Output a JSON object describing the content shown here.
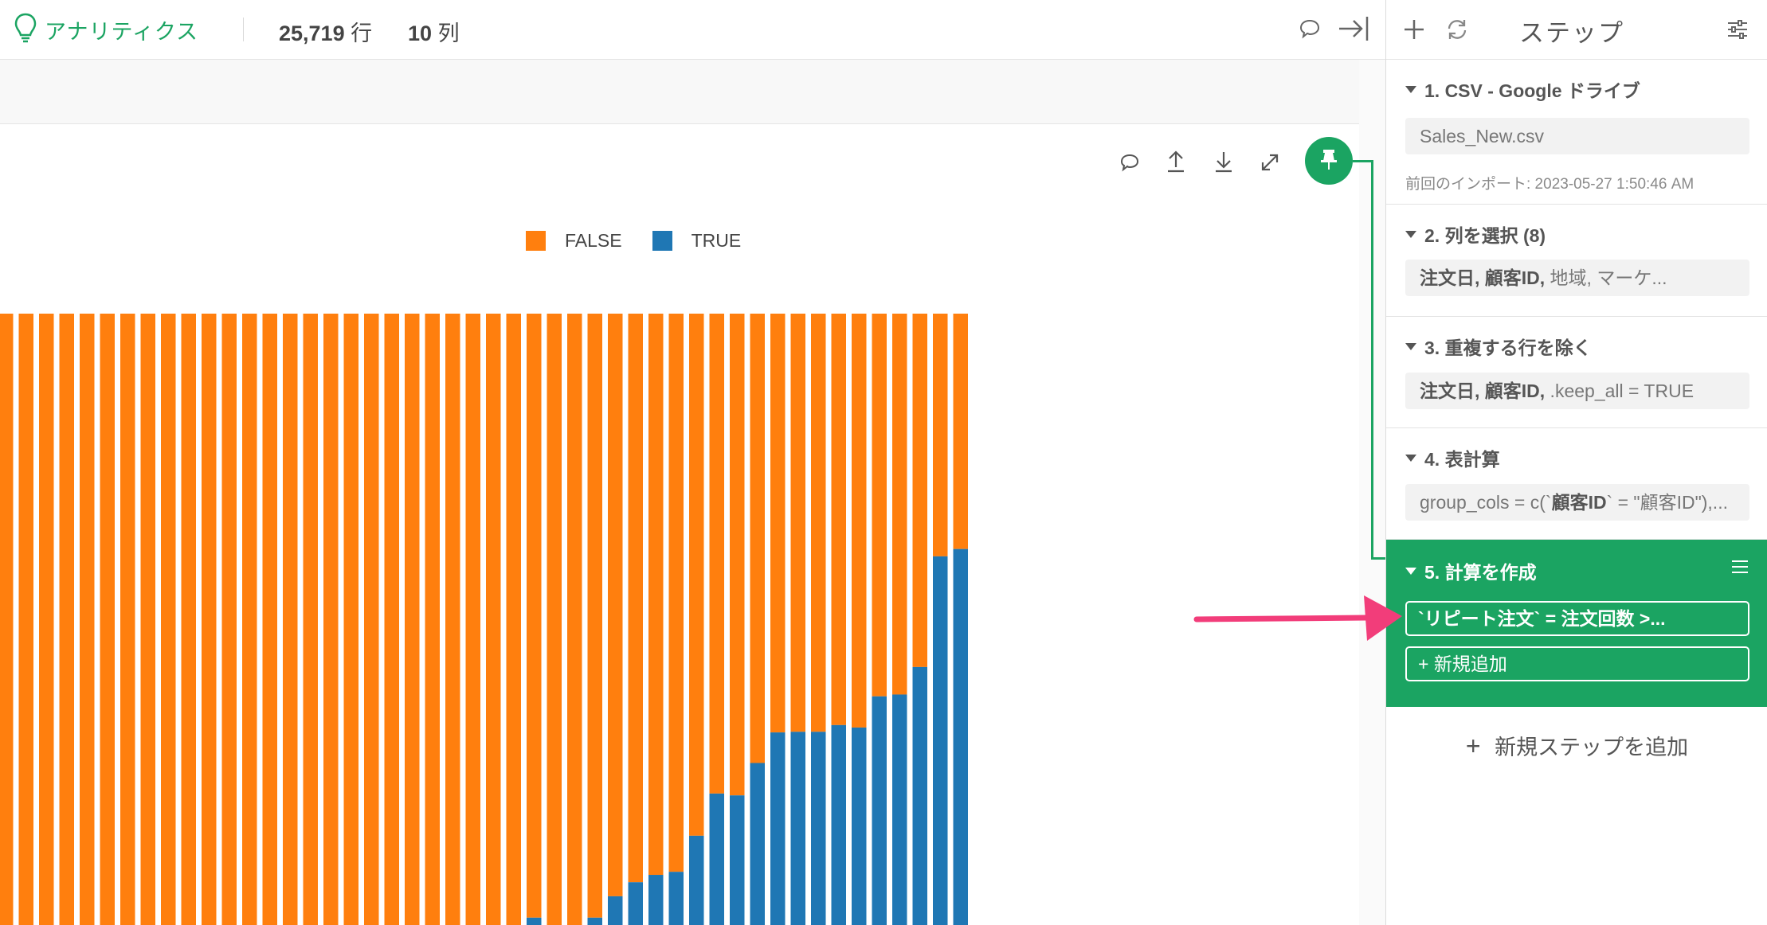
{
  "header": {
    "app_title": "アナリティクス",
    "row_count": "25,719",
    "row_unit": "行",
    "col_count": "10",
    "col_unit": "列"
  },
  "icons": {
    "brand": "lightbulb-icon",
    "comment": "comment-icon",
    "collapse": "collapse-right-icon",
    "upload": "upload-icon",
    "download": "download-icon",
    "expand": "expand-icon",
    "pin": "pin-icon",
    "add": "plus-icon",
    "refresh": "refresh-icon",
    "settings": "sliders-icon",
    "menu": "hamburger-icon"
  },
  "colors": {
    "brand": "#1ba462",
    "false_series": "#ff7f0e",
    "true_series": "#1f77b4",
    "annotation_arrow": "#f23d7a"
  },
  "panel": {
    "title": "ステップ",
    "steps": [
      {
        "title": "1. CSV - Google ドライブ",
        "content": "Sales_New.csv",
        "note": "前回のインポート: 2023-05-27 1:50:46 AM"
      },
      {
        "title": "2. 列を選択 (8)",
        "content_bold": "注文日, 顧客ID,",
        "content_rest": " 地域, マーケ..."
      },
      {
        "title": "3. 重複する行を除く",
        "content_bold": "注文日, 顧客ID,",
        "content_rest": " .keep_all = TRUE"
      },
      {
        "title": "4. 表計算",
        "content_pre": "group_cols = c(`",
        "content_bold": "顧客ID",
        "content_rest": "` = \"顧客ID\"),..."
      },
      {
        "title": "5. 計算を作成",
        "field": "`リピート注文` = 注文回数 >...",
        "add_new": "新規追加",
        "active": true
      }
    ],
    "add_step": "新規ステップを追加"
  },
  "chart_data": {
    "type": "bar",
    "stacked": true,
    "normalized": true,
    "legend_position": "top-center",
    "series": [
      {
        "name": "FALSE",
        "values": [
          1,
          1,
          1,
          1,
          1,
          1,
          1,
          1,
          1,
          1,
          1,
          1,
          1,
          1,
          1,
          1,
          1,
          1,
          1,
          1,
          1,
          1,
          1,
          1,
          1,
          1,
          0.988,
          1,
          1,
          0.988,
          0.953,
          0.93,
          0.918,
          0.913,
          0.854,
          0.785,
          0.788,
          0.735,
          0.685,
          0.684,
          0.684,
          0.673,
          0.677,
          0.626,
          0.623,
          0.578,
          0.397,
          0.385
        ]
      },
      {
        "name": "TRUE",
        "values": [
          0,
          0,
          0,
          0,
          0,
          0,
          0,
          0,
          0,
          0,
          0,
          0,
          0,
          0,
          0,
          0,
          0,
          0,
          0,
          0,
          0,
          0,
          0,
          0,
          0,
          0,
          0.012,
          0,
          0,
          0.012,
          0.047,
          0.07,
          0.082,
          0.087,
          0.146,
          0.215,
          0.212,
          0.265,
          0.315,
          0.316,
          0.316,
          0.327,
          0.323,
          0.374,
          0.377,
          0.422,
          0.603,
          0.615
        ]
      }
    ]
  }
}
